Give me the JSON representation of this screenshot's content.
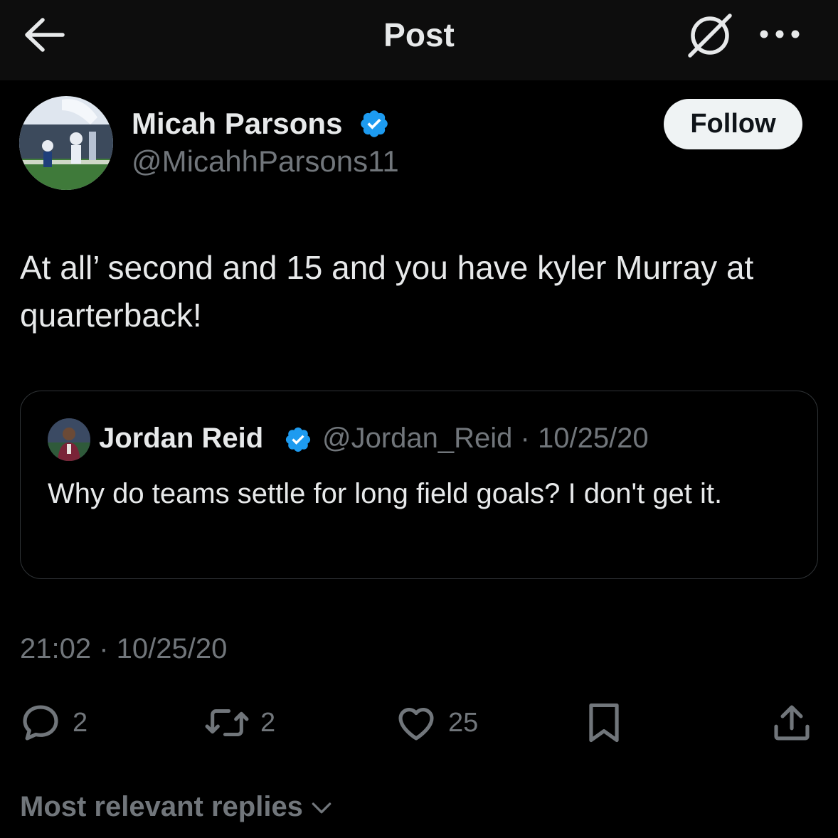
{
  "header": {
    "title": "Post",
    "back_icon": "arrow-left-icon",
    "grok_icon": "grok-icon",
    "more_icon": "more-icon"
  },
  "author": {
    "name": "Micah Parsons",
    "handle": "@MicahhParsons11",
    "verified": true,
    "follow_label": "Follow"
  },
  "post": {
    "text": "At all’ second and 15 and you have kyler Murray at quarterback!",
    "timestamp": "21:02 · 10/25/20"
  },
  "quote": {
    "name": "Jordan Reid",
    "handle_date": "@Jordan_Reid · 10/25/20",
    "verified": true,
    "text": "Why do teams settle for long field goals? I don't get it."
  },
  "actions": {
    "replies": "2",
    "reposts": "2",
    "likes": "25"
  },
  "replies_sort": {
    "label": "Most relevant replies"
  },
  "colors": {
    "background": "#000000",
    "text": "#e7e9ea",
    "muted": "#71767b",
    "verified": "#1d9bf0",
    "follow_bg": "#eff3f4"
  }
}
